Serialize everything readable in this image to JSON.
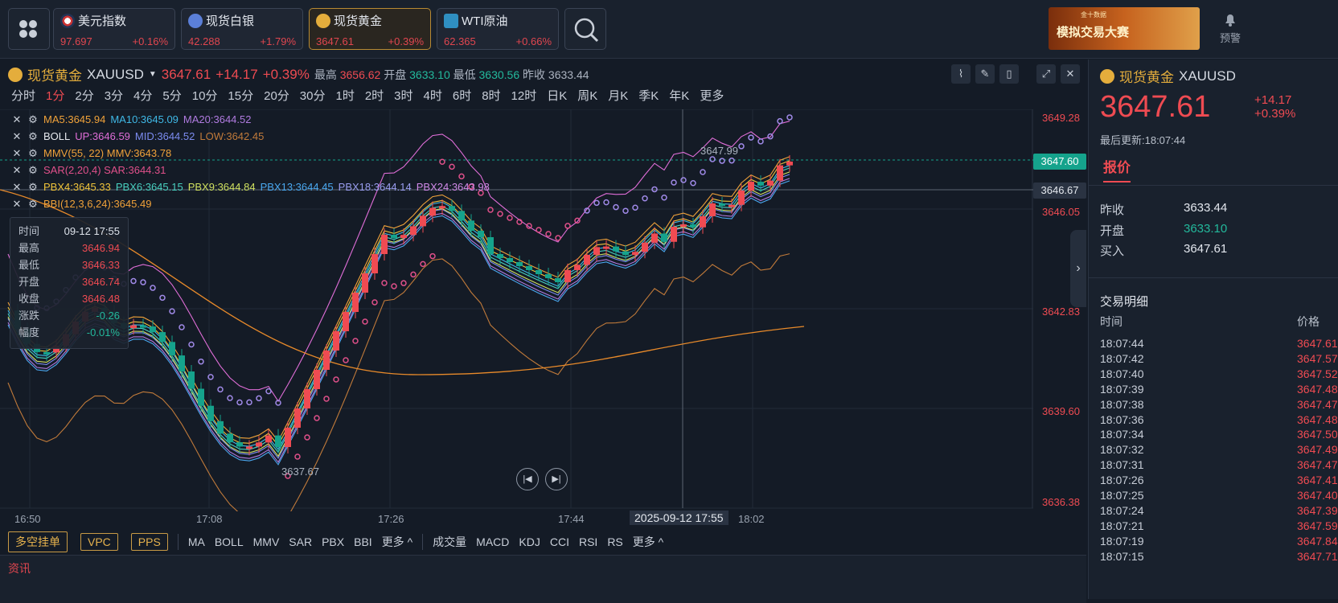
{
  "topbar": {
    "tickers": [
      {
        "name": "美元指数",
        "price": "97.697",
        "change": "+0.16%",
        "flag": "us-flag-icon"
      },
      {
        "name": "现货白银",
        "price": "42.288",
        "change": "+1.79%",
        "flag": "silver-icon"
      },
      {
        "name": "现货黄金",
        "price": "3647.61",
        "change": "+0.39%",
        "flag": "gold-icon"
      },
      {
        "name": "WTI原油",
        "price": "62.365",
        "change": "+0.66%",
        "flag": "oil-icon"
      }
    ],
    "banner_title": "模拟交易大赛",
    "banner_sub": "金十数据",
    "alarm_label": "预警"
  },
  "chart": {
    "name": "现货黄金",
    "symbol": "XAUUSD",
    "price": "3647.61",
    "change": "+14.17",
    "change_pct": "+0.39%",
    "high_label": "最高",
    "high": "3656.62",
    "open_label": "开盘",
    "open": "3633.10",
    "low_label": "最低",
    "low": "3630.56",
    "prev_label": "昨收",
    "prev": "3633.44",
    "periods": [
      "分时",
      "1分",
      "2分",
      "3分",
      "4分",
      "5分",
      "10分",
      "15分",
      "20分",
      "30分",
      "1时",
      "2时",
      "3时",
      "4时",
      "6时",
      "8时",
      "12时",
      "日K",
      "周K",
      "月K",
      "季K",
      "年K",
      "更多"
    ],
    "selected_period": "1分",
    "legend": {
      "ma": [
        "MA5:3645.94",
        "MA10:3645.09",
        "MA20:3644.52"
      ],
      "boll": [
        "BOLL",
        "UP:3646.59",
        "MID:3644.52",
        "LOW:3642.45"
      ],
      "mmv": "MMV(55, 22) MMV:3643.78",
      "sar": "SAR(2,20,4) SAR:3644.31",
      "pbx": [
        "PBX4:3645.33",
        "PBX6:3645.15",
        "PBX9:3644.84",
        "PBX13:3644.45",
        "PBX18:3644.14",
        "PBX24:3643.98"
      ],
      "bbi": "BBI(12,3,6,24):3645.49"
    },
    "tooltip": {
      "time_label": "时间",
      "time": "09-12 17:55",
      "high_label": "最高",
      "high": "3646.94",
      "low_label": "最低",
      "low": "3646.33",
      "open_label": "开盘",
      "open": "3646.74",
      "close_label": "收盘",
      "close": "3646.48",
      "chg_label": "涨跌",
      "chg": "-0.26",
      "pct_label": "幅度",
      "pct": "-0.01%"
    },
    "price_axis": [
      "3649.28",
      "3646.05",
      "3642.83",
      "3639.60",
      "3636.38"
    ],
    "current_tag": "3647.60",
    "cursor_tag": "3646.67",
    "peak_label": "3647.99",
    "trough_label": "3637.67",
    "time_axis": [
      "16:50",
      "17:08",
      "17:26",
      "17:44",
      "18:02"
    ],
    "cursor_time": "2025-09-12 17:55",
    "bottom": {
      "orders": [
        "多空挂单",
        "VPC",
        "PPS"
      ],
      "main_ind": [
        "MA",
        "BOLL",
        "MMV",
        "SAR",
        "PBX",
        "BBI",
        "更多 ^"
      ],
      "sub_ind": [
        "成交量",
        "MACD",
        "KDJ",
        "CCI",
        "RSI",
        "RS",
        "更多 ^"
      ]
    },
    "peek_text": "资讯"
  },
  "sidebar": {
    "name": "现货黄金",
    "symbol": "XAUUSD",
    "price": "3647.61",
    "change": "+14.17",
    "change_pct": "+0.39%",
    "updated": "最后更新:18:07:44",
    "tab": "报价",
    "quotes": [
      {
        "label": "昨收",
        "value": "3633.44"
      },
      {
        "label": "开盘",
        "value": "3633.10"
      },
      {
        "label": "买入",
        "value": "3647.61"
      }
    ],
    "trades_title": "交易明细",
    "col_time": "时间",
    "col_price": "价格",
    "trades": [
      {
        "t": "18:07:44",
        "p": "3647.61"
      },
      {
        "t": "18:07:42",
        "p": "3647.57"
      },
      {
        "t": "18:07:40",
        "p": "3647.52"
      },
      {
        "t": "18:07:39",
        "p": "3647.48"
      },
      {
        "t": "18:07:38",
        "p": "3647.47"
      },
      {
        "t": "18:07:36",
        "p": "3647.48"
      },
      {
        "t": "18:07:34",
        "p": "3647.50"
      },
      {
        "t": "18:07:32",
        "p": "3647.49"
      },
      {
        "t": "18:07:31",
        "p": "3647.47"
      },
      {
        "t": "18:07:26",
        "p": "3647.41"
      },
      {
        "t": "18:07:25",
        "p": "3647.40"
      },
      {
        "t": "18:07:24",
        "p": "3647.39"
      },
      {
        "t": "18:07:21",
        "p": "3647.59"
      },
      {
        "t": "18:07:19",
        "p": "3647.84"
      },
      {
        "t": "18:07:15",
        "p": "3647.71"
      }
    ]
  }
}
